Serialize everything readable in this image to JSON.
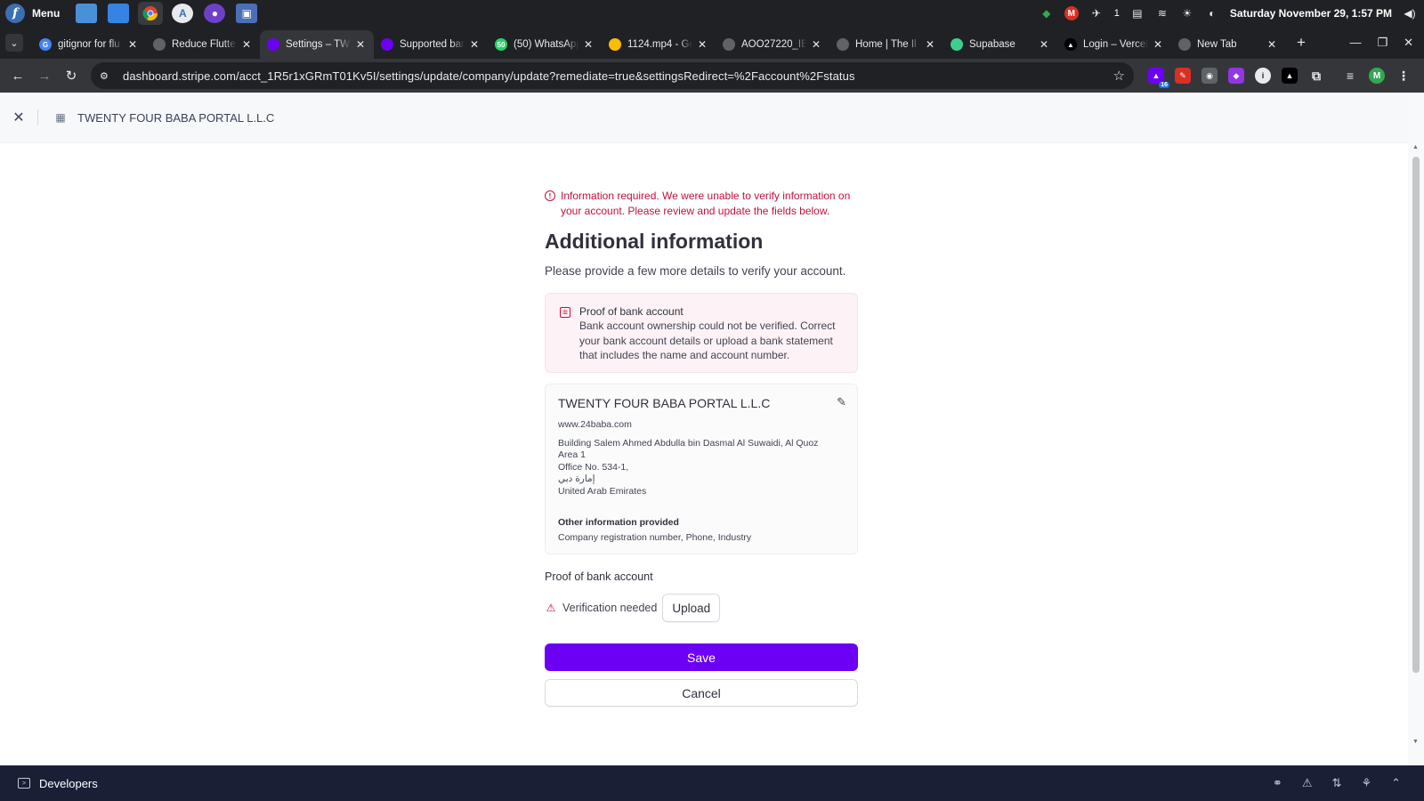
{
  "os_panel": {
    "menu_label": "Menu",
    "clock": "Saturday November 29, 1:57 PM",
    "notification_count": "1"
  },
  "tabs": [
    {
      "title": "gitignor for flu",
      "favicon_color": "#4285f4",
      "favicon": "G"
    },
    {
      "title": "Reduce Flutter",
      "favicon_color": "#5f6368",
      "favicon": ""
    },
    {
      "title": "Settings – TWE",
      "favicon_color": "#6c00f5",
      "favicon": "",
      "active": true
    },
    {
      "title": "Supported ban",
      "favicon_color": "#6c00f5",
      "favicon": ""
    },
    {
      "title": "(50) WhatsApp",
      "favicon_color": "#25d366",
      "favicon": "50"
    },
    {
      "title": "1124.mp4 - Go",
      "favicon_color": "#fbbc04",
      "favicon": ""
    },
    {
      "title": "AOO27220_IB",
      "favicon_color": "#5f6368",
      "favicon": ""
    },
    {
      "title": "Home | The Il",
      "favicon_color": "#5f6368",
      "favicon": ""
    },
    {
      "title": "Supabase",
      "favicon_color": "#3ecf8e",
      "favicon": ""
    },
    {
      "title": "Login – Vercel",
      "favicon_color": "#000000",
      "favicon": "▲"
    },
    {
      "title": "New Tab",
      "favicon_color": "#5f6368",
      "favicon": ""
    }
  ],
  "toolbar": {
    "url": "dashboard.stripe.com/acct_1R5r1xGRmT01Kv5I/settings/update/company/update?remediate=true&settingsRedirect=%2Faccount%2Fstatus",
    "extension_badge": "16",
    "profile_initial": "M"
  },
  "header": {
    "company": "TWENTY FOUR BABA PORTAL L.L.C"
  },
  "main": {
    "alert": "Information required. We were unable to verify information on your account. Please review and update the fields below.",
    "title": "Additional information",
    "subtitle": "Please provide a few more details to verify your account.",
    "error_box": {
      "heading": "Proof of bank account",
      "body": "Bank account ownership could not be verified. Correct your bank account details or upload a bank statement that includes the name and account number."
    },
    "company_card": {
      "name": "TWENTY FOUR BABA PORTAL L.L.C",
      "website": "www.24baba.com",
      "address_line1": "Building Salem Ahmed Abdulla bin Dasmal Al Suwaidi, Al Quoz Area 1",
      "address_line2": "Office No. 534-1,",
      "address_line3": "إمارة دبي",
      "address_line4": "United Arab Emirates",
      "other_label": "Other information provided",
      "other_value": "Company registration number, Phone, Industry"
    },
    "proof_label": "Proof of bank account",
    "verification_status": "Verification needed",
    "upload_label": "Upload",
    "save_label": "Save",
    "cancel_label": "Cancel"
  },
  "footer": {
    "developers_label": "Developers"
  },
  "colors": {
    "accent": "#6c00f5",
    "error": "#c0123c",
    "footer_bg": "#1a1f36"
  }
}
